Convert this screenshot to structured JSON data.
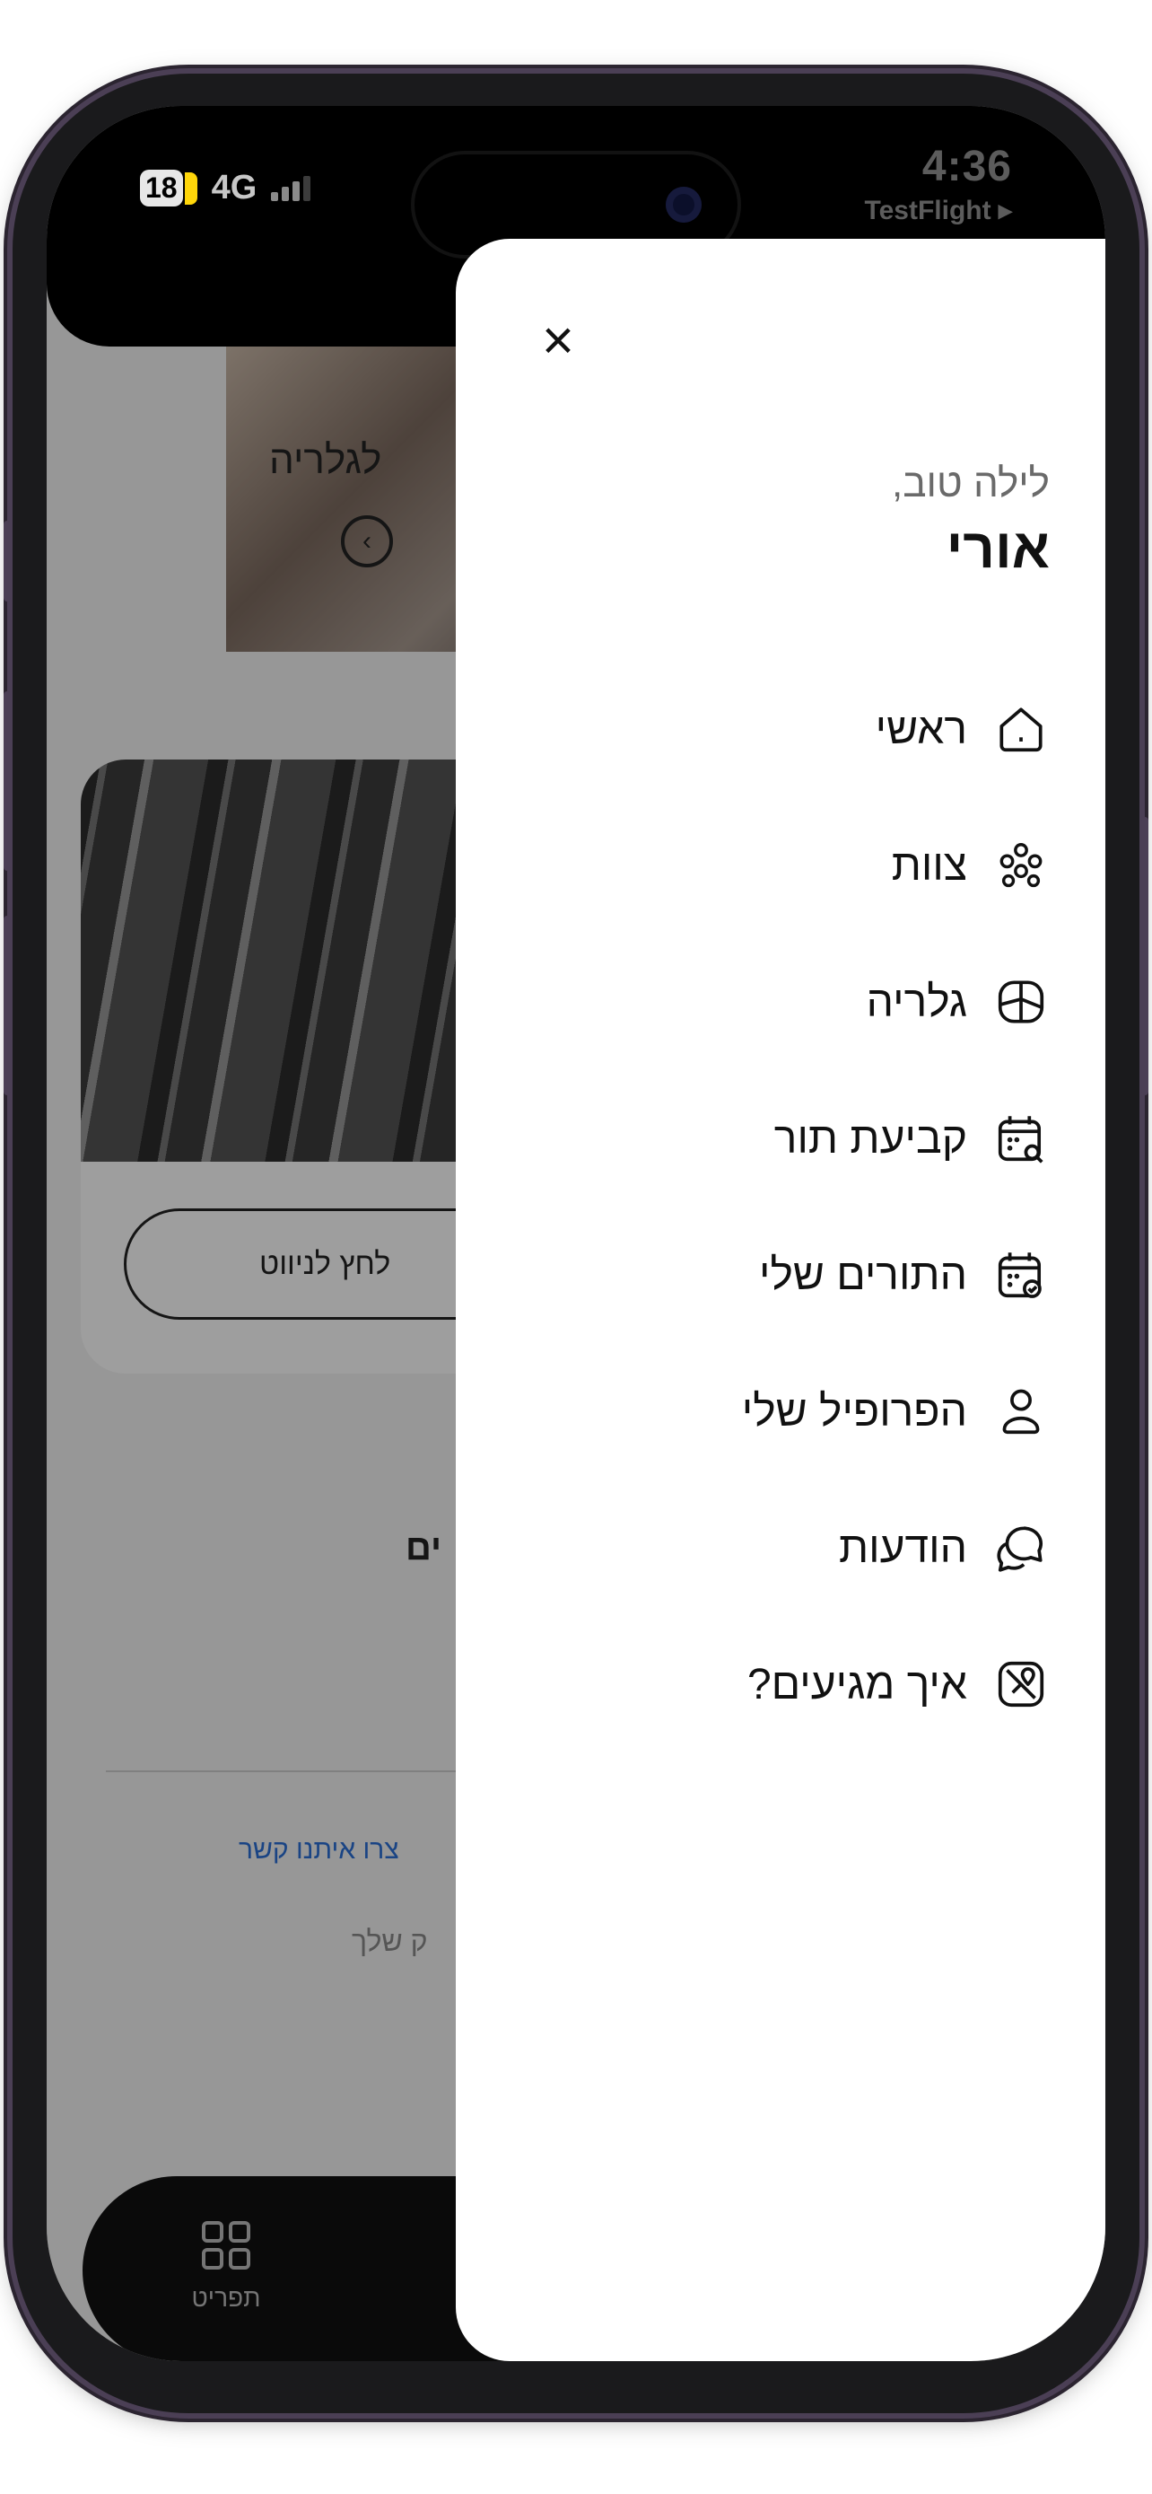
{
  "status_bar": {
    "battery_level": "18",
    "network": "4G",
    "time": "4:36",
    "back_app": "TestFlight ▸"
  },
  "background": {
    "gallery_label": "לגלריה",
    "card_button": "לחץ לניווט",
    "partial_heading": "ים",
    "contact_link": "צרו איתנו קשר",
    "muted_text": "ק שלך",
    "tabs": [
      {
        "label": "תפריט",
        "icon": "menu-grid-icon"
      }
    ]
  },
  "drawer": {
    "close_icon": "close-icon",
    "greeting": "לילה טוב,",
    "user_name": "אורי",
    "menu": [
      {
        "label": "ראשי",
        "icon": "home-icon"
      },
      {
        "label": "צוות",
        "icon": "team-icon"
      },
      {
        "label": "גלריה",
        "icon": "gallery-icon"
      },
      {
        "label": "קביעת תור",
        "icon": "calendar-search-icon"
      },
      {
        "label": "התורים שלי",
        "icon": "calendar-check-icon"
      },
      {
        "label": "הפרופיל שלי",
        "icon": "profile-icon"
      },
      {
        "label": "הודעות",
        "icon": "messages-icon"
      },
      {
        "label": "איך מגיעים?",
        "icon": "map-icon"
      }
    ]
  }
}
